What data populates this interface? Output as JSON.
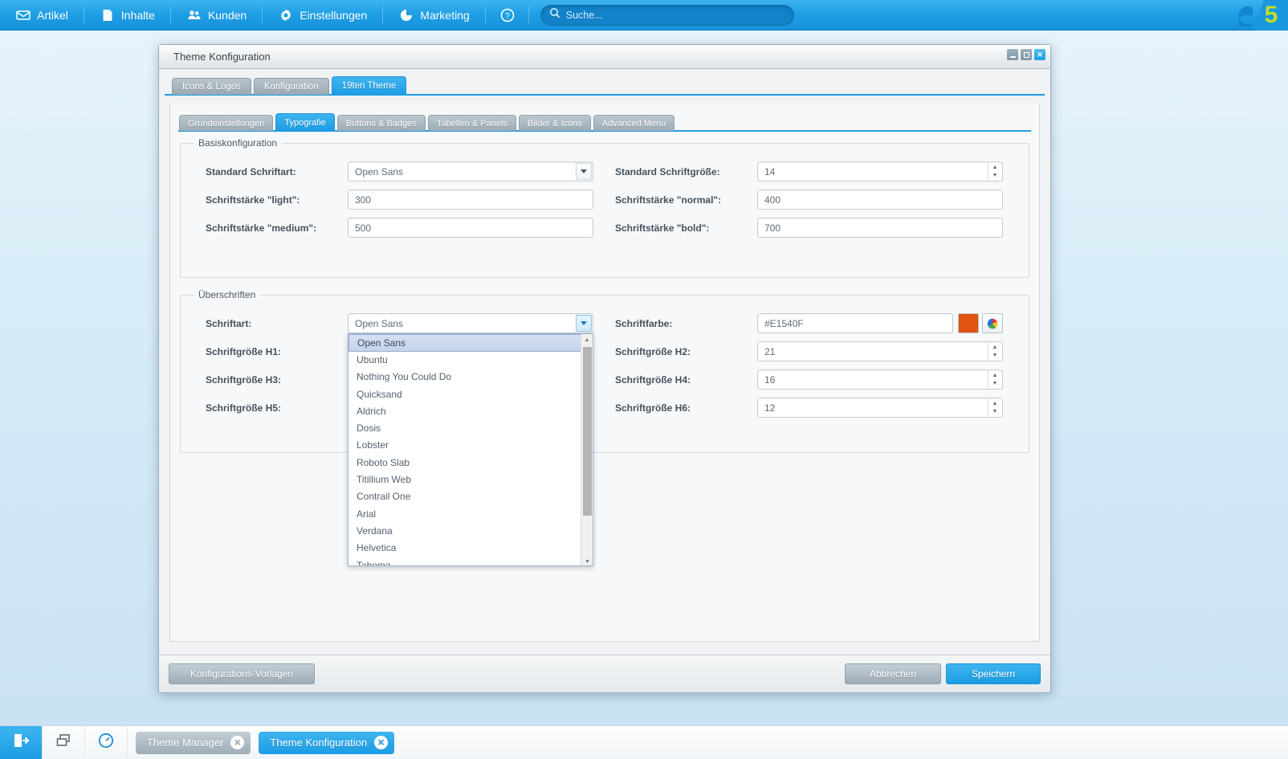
{
  "topbar": {
    "nav": [
      {
        "label": "Artikel",
        "icon": "inbox-icon"
      },
      {
        "label": "Inhalte",
        "icon": "document-icon"
      },
      {
        "label": "Kunden",
        "icon": "users-icon"
      },
      {
        "label": "Einstellungen",
        "icon": "gear-icon"
      },
      {
        "label": "Marketing",
        "icon": "pie-chart-icon"
      }
    ],
    "help_icon": "help-icon",
    "search": {
      "placeholder": "Suche...",
      "value": "",
      "icon": "search-icon"
    },
    "logo": {
      "mark": "shopware-swirl-icon",
      "version": "5"
    }
  },
  "window": {
    "title": "Theme Konfiguration",
    "controls": {
      "minimize": "minimize-icon",
      "maximize": "maximize-icon",
      "close": "close-icon"
    },
    "outer_tabs": [
      {
        "label": "Icons & Logos",
        "active": false
      },
      {
        "label": "Konfiguration",
        "active": false
      },
      {
        "label": "19ten Theme",
        "active": true
      }
    ],
    "inner_tabs": [
      {
        "label": "Grundeinstellungen",
        "active": false
      },
      {
        "label": "Typografie",
        "active": true
      },
      {
        "label": "Buttons & Badges",
        "active": false
      },
      {
        "label": "Tabellen & Panels",
        "active": false
      },
      {
        "label": "Bilder & Icons",
        "active": false
      },
      {
        "label": "Advanced Menu",
        "active": false
      }
    ],
    "footer": {
      "templates_label": "Konfigurations-Vorlagen",
      "cancel_label": "Abbrechen",
      "save_label": "Speichern"
    }
  },
  "basiskonfiguration": {
    "legend": "Basiskonfiguration",
    "fields": {
      "standard_schriftart": {
        "label": "Standard Schriftart:",
        "value": "Open Sans",
        "type": "combo"
      },
      "standard_schriftgroesse": {
        "label": "Standard Schriftgröße:",
        "value": "14",
        "type": "spinner"
      },
      "schriftstaerke_light": {
        "label": "Schriftstärke \"light\":",
        "value": "300",
        "type": "text"
      },
      "schriftstaerke_normal": {
        "label": "Schriftstärke \"normal\":",
        "value": "400",
        "type": "text"
      },
      "schriftstaerke_medium": {
        "label": "Schriftstärke \"medium\":",
        "value": "500",
        "type": "text"
      },
      "schriftstaerke_bold": {
        "label": "Schriftstärke \"bold\":",
        "value": "700",
        "type": "text"
      }
    }
  },
  "ueberschriften": {
    "legend": "Überschriften",
    "fields": {
      "schriftart": {
        "label": "Schriftart:",
        "value": "Open Sans",
        "type": "combo"
      },
      "schriftfarbe": {
        "label": "Schriftfarbe:",
        "value": "#E1540F",
        "type": "color",
        "swatch": "#E1540F"
      },
      "h1": {
        "label": "Schriftgröße H1:",
        "value": "",
        "type": "spinner"
      },
      "h2": {
        "label": "Schriftgröße H2:",
        "value": "21",
        "type": "spinner"
      },
      "h3": {
        "label": "Schriftgröße H3:",
        "value": "",
        "type": "spinner"
      },
      "h4": {
        "label": "Schriftgröße H4:",
        "value": "16",
        "type": "spinner"
      },
      "h5": {
        "label": "Schriftgröße H5:",
        "value": "",
        "type": "spinner"
      },
      "h6": {
        "label": "Schriftgröße H6:",
        "value": "12",
        "type": "spinner"
      }
    },
    "dropdown": {
      "open": true,
      "selected": "Open Sans",
      "options": [
        "Open Sans",
        "Ubuntu",
        "Nothing You Could Do",
        "Quicksand",
        "Aldrich",
        "Dosis",
        "Lobster",
        "Roboto Slab",
        "Titillium Web",
        "Contrail One",
        "Arial",
        "Verdana",
        "Helvetica",
        "Tahoma"
      ]
    }
  },
  "taskbar": {
    "logout_icon": "logout-icon",
    "windows_icon": "windows-stack-icon",
    "performance_icon": "gauge-icon",
    "tasks": [
      {
        "label": "Theme Manager",
        "active": false,
        "close_icon": "close-circle-icon"
      },
      {
        "label": "Theme Konfiguration",
        "active": true,
        "close_icon": "close-circle-icon"
      }
    ]
  },
  "colors": {
    "accent": "#1e9ee4",
    "accent_light": "#3eb5f0",
    "grey_button": "#9dabb6",
    "heading_color": "#E1540F",
    "logo_green": "#bcdd28"
  }
}
